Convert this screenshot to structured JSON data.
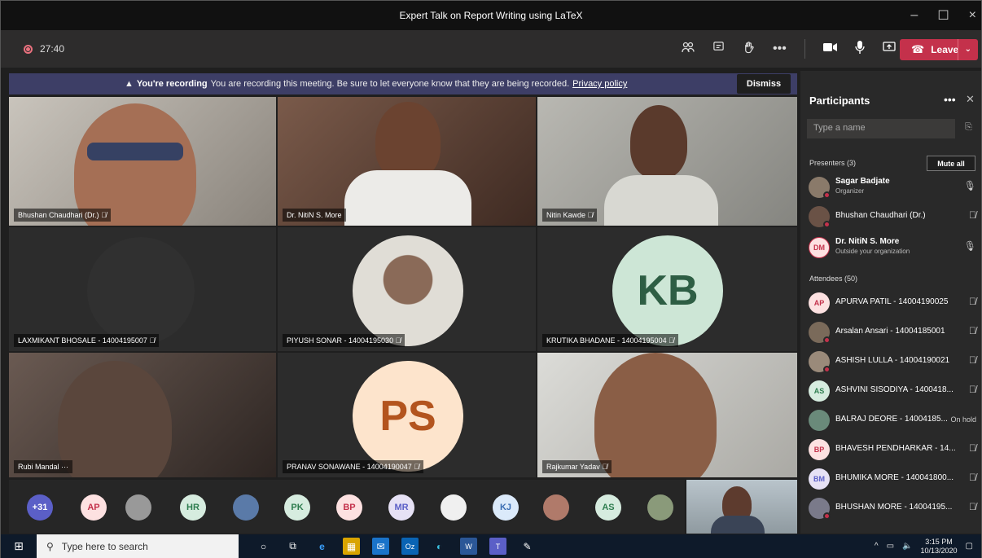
{
  "window": {
    "title": "Expert Talk on Report Writing using LaTeX"
  },
  "toolbar": {
    "timer": "27:40",
    "leave_label": "Leave"
  },
  "banner": {
    "strong": "You're recording",
    "message": "You are recording this meeting. Be sure to let everyone know that they are being recorded.",
    "link": "Privacy policy",
    "dismiss": "Dismiss"
  },
  "tiles": [
    {
      "name": "Bhushan Chaudhari (Dr.)"
    },
    {
      "name": "Dr. NitiN S. More"
    },
    {
      "name": "Nitin Kawde"
    },
    {
      "name": "LAXMIKANT BHOSALE - 14004195007"
    },
    {
      "name": "PIYUSH SONAR - 14004195030"
    },
    {
      "name": "KRUTIKA BHADANE - 14004195004",
      "initials": "KB"
    },
    {
      "name": "Rubi Mandal",
      "extra": "···"
    },
    {
      "name": "PRANAV SONAWANE - 14004190047",
      "initials": "PS"
    },
    {
      "name": "Rajkumar Yadav"
    }
  ],
  "strip": {
    "overflow": "+31",
    "chips": [
      "AP",
      "HR",
      "PK",
      "BP",
      "MR",
      "KJ",
      "AS"
    ]
  },
  "panel": {
    "title": "Participants",
    "search_placeholder": "Type a name",
    "presenters_label": "Presenters (3)",
    "mute_all": "Mute all",
    "attendees_label": "Attendees (50)",
    "presenters": [
      {
        "name": "Sagar Badjate",
        "sub": "Organizer"
      },
      {
        "name": "Bhushan Chaudhari (Dr.)"
      },
      {
        "name": "Dr. NitiN S. More",
        "sub": "Outside your organization",
        "initials": "DM"
      }
    ],
    "attendees": [
      {
        "name": "APURVA PATIL - 14004190025",
        "initials": "AP"
      },
      {
        "name": "Arsalan Ansari - 14004185001"
      },
      {
        "name": "ASHISH LULLA - 14004190021"
      },
      {
        "name": "ASHVINI SISODIYA - 1400418...",
        "initials": "AS"
      },
      {
        "name": "BALRAJ DEORE - 14004185...",
        "status": "On hold"
      },
      {
        "name": "BHAVESH PENDHARKAR - 14...",
        "initials": "BP"
      },
      {
        "name": "BHUMIKA MORE - 140041800...",
        "initials": "BM"
      },
      {
        "name": "BHUSHAN MORE - 14004195..."
      }
    ]
  },
  "taskbar": {
    "search_placeholder": "Type here to search",
    "time": "3:15 PM",
    "date": "10/13/2020"
  }
}
